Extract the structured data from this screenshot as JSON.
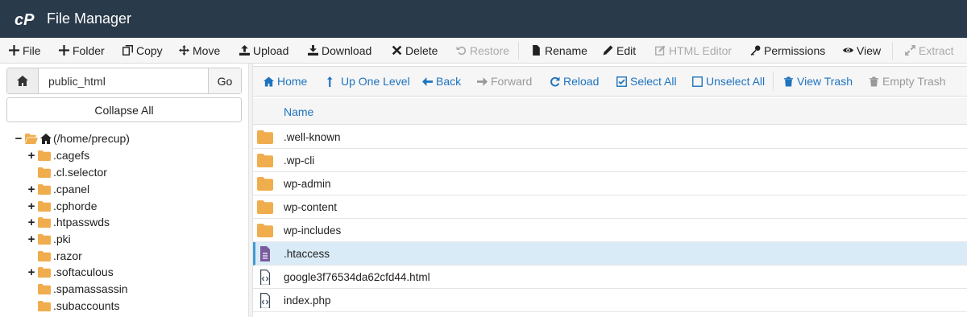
{
  "app": {
    "title": "File Manager"
  },
  "toolbar": {
    "file": "File",
    "folder": "Folder",
    "copy": "Copy",
    "move": "Move",
    "upload": "Upload",
    "download": "Download",
    "delete": "Delete",
    "restore": "Restore",
    "rename": "Rename",
    "edit": "Edit",
    "html_editor": "HTML Editor",
    "permissions": "Permissions",
    "view": "View",
    "extract": "Extract"
  },
  "path": {
    "value": "public_html",
    "go_label": "Go"
  },
  "collapse_label": "Collapse All",
  "tree": [
    {
      "label": "(/home/precup)",
      "toggle": "−",
      "open": true
    },
    {
      "label": ".cagefs",
      "toggle": "+"
    },
    {
      "label": ".cl.selector",
      "toggle": ""
    },
    {
      "label": ".cpanel",
      "toggle": "+"
    },
    {
      "label": ".cphorde",
      "toggle": "+"
    },
    {
      "label": ".htpasswds",
      "toggle": "+"
    },
    {
      "label": ".pki",
      "toggle": "+"
    },
    {
      "label": ".razor",
      "toggle": ""
    },
    {
      "label": ".softaculous",
      "toggle": "+"
    },
    {
      "label": ".spamassassin",
      "toggle": ""
    },
    {
      "label": ".subaccounts",
      "toggle": ""
    }
  ],
  "nav": {
    "home": "Home",
    "up_one_level": "Up One Level",
    "back": "Back",
    "forward": "Forward",
    "reload": "Reload",
    "select_all": "Select All",
    "unselect_all": "Unselect All",
    "view_trash": "View Trash",
    "empty_trash": "Empty Trash"
  },
  "files": {
    "column_name": "Name",
    "rows": [
      {
        "name": ".well-known",
        "type": "folder"
      },
      {
        "name": ".wp-cli",
        "type": "folder"
      },
      {
        "name": "wp-admin",
        "type": "folder"
      },
      {
        "name": "wp-content",
        "type": "folder"
      },
      {
        "name": "wp-includes",
        "type": "folder"
      },
      {
        "name": ".htaccess",
        "type": "text",
        "selected": true
      },
      {
        "name": "google3f76534da62cfd44.html",
        "type": "code"
      },
      {
        "name": "index.php",
        "type": "code"
      }
    ]
  },
  "colors": {
    "header_bg": "#293a4a",
    "link_blue": "#1e73be",
    "folder": "#f0ad4e",
    "selected_row": "#d9ebf7",
    "text_file": "#7a5c9e"
  }
}
